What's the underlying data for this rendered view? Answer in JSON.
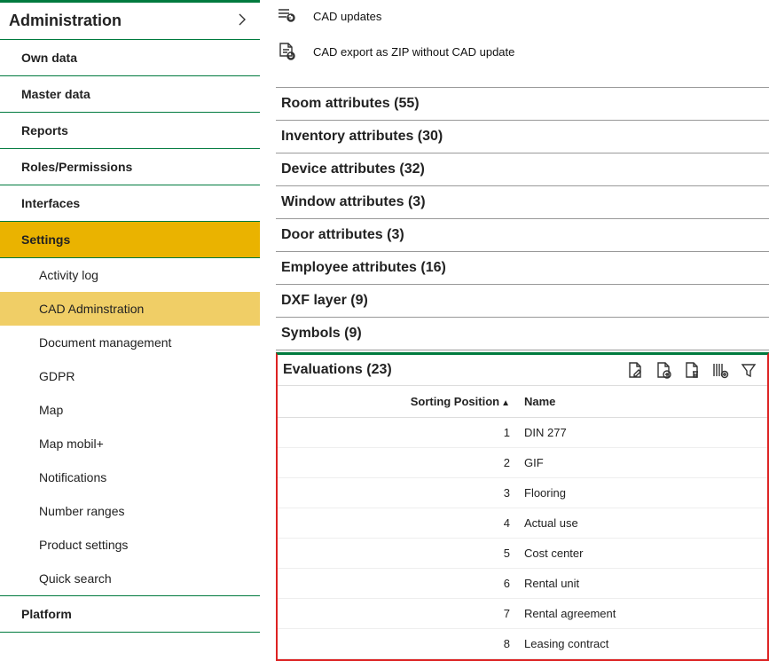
{
  "sidebar": {
    "title": "Administration",
    "items": [
      {
        "label": "Own data"
      },
      {
        "label": "Master data"
      },
      {
        "label": "Reports"
      },
      {
        "label": "Roles/Permissions"
      },
      {
        "label": "Interfaces"
      },
      {
        "label": "Settings",
        "selected": true
      },
      {
        "label": "Platform"
      }
    ],
    "settings_children": [
      {
        "label": "Activity log"
      },
      {
        "label": "CAD Adminstration",
        "selected": true
      },
      {
        "label": "Document management"
      },
      {
        "label": "GDPR"
      },
      {
        "label": "Map"
      },
      {
        "label": "Map mobil+"
      },
      {
        "label": "Notifications"
      },
      {
        "label": "Number ranges"
      },
      {
        "label": "Product settings"
      },
      {
        "label": "Quick search"
      }
    ]
  },
  "actions": [
    {
      "label": "CAD updates"
    },
    {
      "label": "CAD export as ZIP without CAD update"
    }
  ],
  "sections": [
    {
      "label": "Room attributes (55)"
    },
    {
      "label": "Inventory attributes (30)"
    },
    {
      "label": "Device attributes (32)"
    },
    {
      "label": "Window attributes (3)"
    },
    {
      "label": "Door attributes (3)"
    },
    {
      "label": "Employee attributes (16)"
    },
    {
      "label": "DXF layer (9)"
    },
    {
      "label": "Symbols (9)"
    }
  ],
  "evaluations": {
    "title": "Evaluations (23)",
    "columns": {
      "pos": "Sorting Position",
      "name": "Name"
    },
    "rows": [
      {
        "pos": "1",
        "name": "DIN 277"
      },
      {
        "pos": "2",
        "name": "GIF"
      },
      {
        "pos": "3",
        "name": "Flooring"
      },
      {
        "pos": "4",
        "name": "Actual use"
      },
      {
        "pos": "5",
        "name": "Cost center"
      },
      {
        "pos": "6",
        "name": "Rental unit"
      },
      {
        "pos": "7",
        "name": "Rental agreement"
      },
      {
        "pos": "8",
        "name": "Leasing contract"
      }
    ]
  }
}
